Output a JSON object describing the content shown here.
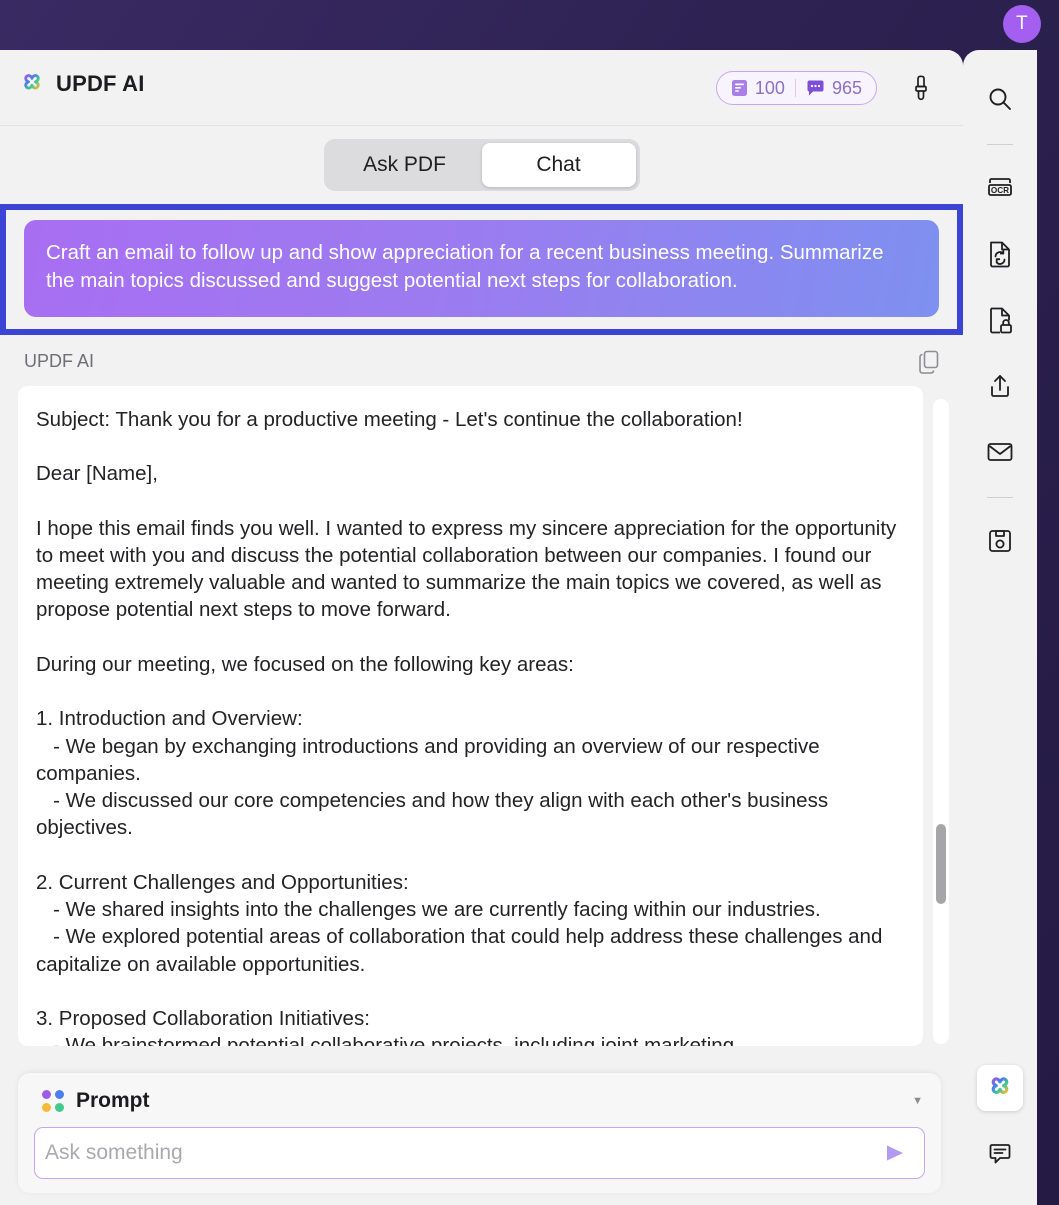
{
  "window": {
    "avatar_initial": "T",
    "accent_purple": "#a45ff0",
    "selection_blue": "#3b44d5",
    "background_dark": "#2e2453"
  },
  "header": {
    "brand_title": "UPDF AI",
    "logo_icon": "updf-clover-logo",
    "credits": {
      "document_icon": "document-credit-icon",
      "document_count": "100",
      "chat_icon": "chat-credit-icon",
      "chat_count": "965"
    },
    "clear_icon": "brush-icon"
  },
  "tabs": [
    {
      "label": "Ask PDF",
      "active": false
    },
    {
      "label": "Chat",
      "active": true
    }
  ],
  "conversation": {
    "user_message": "Craft an email to follow up and show appreciation for a recent business meeting. Summarize the main topics discussed and suggest potential next steps for collaboration.",
    "assistant_name": "UPDF AI",
    "copy_icon": "copy-icon",
    "assistant_message": "Subject: Thank you for a productive meeting - Let's continue the collaboration!\n\nDear [Name],\n\nI hope this email finds you well. I wanted to express my sincere appreciation for the opportunity to meet with you and discuss the potential collaboration between our companies. I found our meeting extremely valuable and wanted to summarize the main topics we covered, as well as propose potential next steps to move forward.\n\nDuring our meeting, we focused on the following key areas:\n\n1. Introduction and Overview:\n   - We began by exchanging introductions and providing an overview of our respective companies.\n   - We discussed our core competencies and how they align with each other's business objectives.\n\n2. Current Challenges and Opportunities:\n   - We shared insights into the challenges we are currently facing within our industries.\n   - We explored potential areas of collaboration that could help address these challenges and capitalize on available opportunities.\n\n3. Proposed Collaboration Initiatives:\n   - We brainstormed potential collaborative projects, including joint marketing"
  },
  "prompt_bar": {
    "icon": "four-dots-icon",
    "label": "Prompt",
    "dropdown_icon": "chevron-down-icon",
    "input_value": "",
    "input_placeholder": "Ask something",
    "send_icon": "send-arrow-icon",
    "dot_colors": [
      "#9b5de5",
      "#4a7ef0",
      "#f5b93c",
      "#43c98a"
    ]
  },
  "right_rail": [
    {
      "name": "search-icon",
      "label": "Search"
    },
    {
      "name": "divider",
      "label": ""
    },
    {
      "name": "ocr-icon",
      "label": "OCR"
    },
    {
      "name": "convert-icon",
      "label": "Convert"
    },
    {
      "name": "protect-icon",
      "label": "Protect"
    },
    {
      "name": "share-icon",
      "label": "Share"
    },
    {
      "name": "email-icon",
      "label": "Email"
    },
    {
      "name": "divider",
      "label": ""
    },
    {
      "name": "save-icon",
      "label": "Save"
    }
  ],
  "right_rail_bottom": [
    {
      "name": "updf-ai-icon",
      "label": "UPDF AI",
      "active": true
    },
    {
      "name": "comment-icon",
      "label": "Comment",
      "active": false
    }
  ]
}
